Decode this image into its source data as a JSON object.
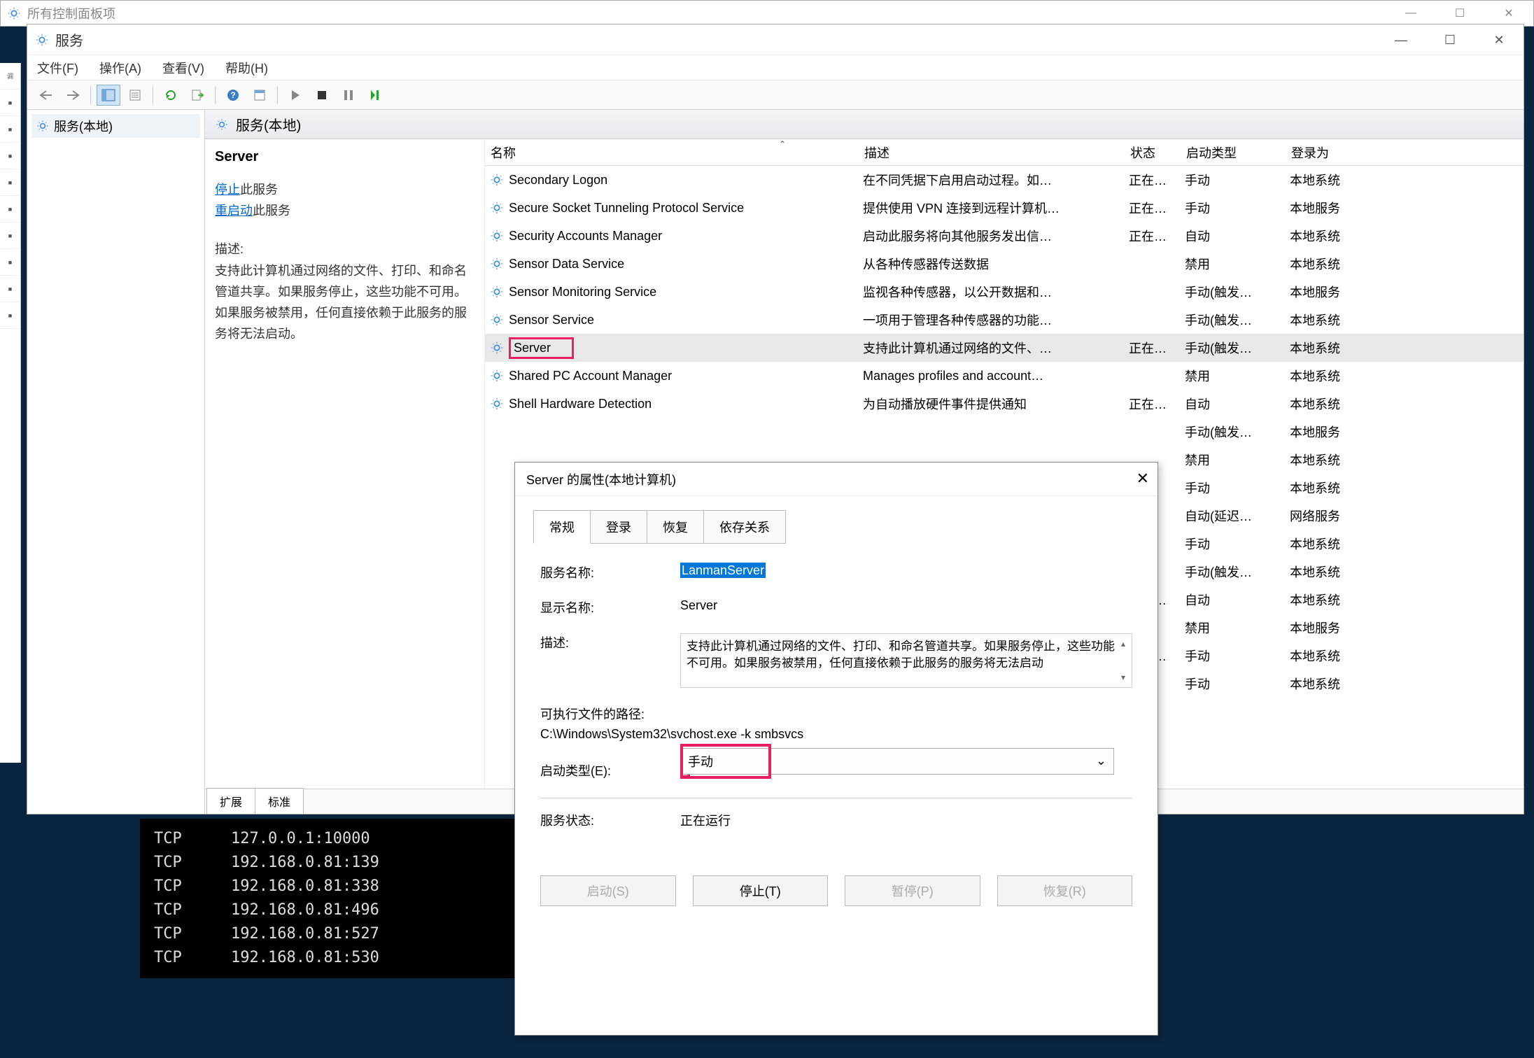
{
  "cp_window": {
    "title": "所有控制面板项"
  },
  "svc_window": {
    "title": "服务",
    "menu": [
      "文件(F)",
      "操作(A)",
      "查看(V)",
      "帮助(H)"
    ],
    "tree_item": "服务(本地)",
    "panel_title": "服务(本地)"
  },
  "desc_panel": {
    "service_name": "Server",
    "stop_link": "停止",
    "stop_suffix": "此服务",
    "restart_link": "重启动",
    "restart_suffix": "此服务",
    "desc_label": "描述:",
    "desc_text": "支持此计算机通过网络的文件、打印、和命名管道共享。如果服务停止，这些功能不可用。如果服务被禁用，任何直接依赖于此服务的服务将无法启动。"
  },
  "columns": {
    "name": "名称",
    "desc": "描述",
    "status": "状态",
    "start": "启动类型",
    "logon": "登录为"
  },
  "rows": [
    {
      "name": "Secondary Logon",
      "desc": "在不同凭据下启用启动过程。如…",
      "status": "正在…",
      "start": "手动",
      "logon": "本地系统"
    },
    {
      "name": "Secure Socket Tunneling Protocol Service",
      "desc": "提供使用 VPN 连接到远程计算机…",
      "status": "正在…",
      "start": "手动",
      "logon": "本地服务"
    },
    {
      "name": "Security Accounts Manager",
      "desc": "启动此服务将向其他服务发出信…",
      "status": "正在…",
      "start": "自动",
      "logon": "本地系统"
    },
    {
      "name": "Sensor Data Service",
      "desc": "从各种传感器传送数据",
      "status": "",
      "start": "禁用",
      "logon": "本地系统"
    },
    {
      "name": "Sensor Monitoring Service",
      "desc": "监视各种传感器，以公开数据和…",
      "status": "",
      "start": "手动(触发…",
      "logon": "本地服务"
    },
    {
      "name": "Sensor Service",
      "desc": "一项用于管理各种传感器的功能…",
      "status": "",
      "start": "手动(触发…",
      "logon": "本地系统"
    },
    {
      "name": "Server",
      "desc": "支持此计算机通过网络的文件、…",
      "status": "正在…",
      "start": "手动(触发…",
      "logon": "本地系统",
      "selected": true,
      "highlight": true
    },
    {
      "name": "Shared PC Account Manager",
      "desc": "Manages profiles and account…",
      "status": "",
      "start": "禁用",
      "logon": "本地系统"
    },
    {
      "name": "Shell Hardware Detection",
      "desc": "为自动播放硬件事件提供通知",
      "status": "正在…",
      "start": "自动",
      "logon": "本地系统"
    },
    {
      "name": "",
      "desc": "",
      "status": "",
      "start": "手动(触发…",
      "logon": "本地服务"
    },
    {
      "name": "",
      "desc": "",
      "status": "",
      "start": "禁用",
      "logon": "本地系统"
    },
    {
      "name": "",
      "desc": "",
      "status": "",
      "start": "手动",
      "logon": "本地系统"
    },
    {
      "name": "",
      "desc": "",
      "status": "",
      "start": "自动(延迟…",
      "logon": "网络服务"
    },
    {
      "name": "",
      "desc": "",
      "status": "",
      "start": "手动",
      "logon": "本地系统"
    },
    {
      "name": "",
      "desc": "",
      "status": "",
      "start": "手动(触发…",
      "logon": "本地系统"
    },
    {
      "name": "",
      "desc": "",
      "status": "正在…",
      "start": "自动",
      "logon": "本地系统"
    },
    {
      "name": "",
      "desc": "",
      "status": "",
      "start": "禁用",
      "logon": "本地服务"
    },
    {
      "name": "",
      "desc": "",
      "status": "正在…",
      "start": "手动",
      "logon": "本地系统"
    },
    {
      "name": "",
      "desc": "",
      "status": "",
      "start": "手动",
      "logon": "本地系统"
    }
  ],
  "bottom_tabs": [
    "扩展",
    "标准"
  ],
  "dialog": {
    "title": "Server 的属性(本地计算机)",
    "tabs": [
      "常规",
      "登录",
      "恢复",
      "依存关系"
    ],
    "labels": {
      "svc_name": "服务名称:",
      "disp_name": "显示名称:",
      "desc": "描述:",
      "exe_path_label": "可执行文件的路径:",
      "start_type": "启动类型(E):",
      "status": "服务状态:"
    },
    "values": {
      "svc_name": "LanmanServer",
      "disp_name": "Server",
      "desc": "支持此计算机通过网络的文件、打印、和命名管道共享。如果服务停止，这些功能不可用。如果服务被禁用，任何直接依赖于此服务的服务将无法启动",
      "exe_path": "C:\\Windows\\System32\\svchost.exe -k smbsvcs",
      "start_type": "手动",
      "status": "正在运行"
    },
    "buttons": {
      "start": "启动(S)",
      "stop": "停止(T)",
      "pause": "暂停(P)",
      "resume": "恢复(R)"
    }
  },
  "terminal": [
    {
      "p": "TCP",
      "a": "127.0.0.1:10000"
    },
    {
      "p": "TCP",
      "a": "192.168.0.81:139"
    },
    {
      "p": "TCP",
      "a": "192.168.0.81:338"
    },
    {
      "p": "TCP",
      "a": "192.168.0.81:496"
    },
    {
      "p": "TCP",
      "a": "192.168.0.81:527"
    },
    {
      "p": "TCP",
      "a": "192.168.0.81:530"
    }
  ]
}
